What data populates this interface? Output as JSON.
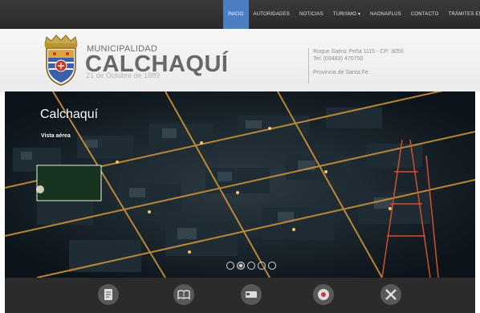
{
  "nav": {
    "items": [
      {
        "label": "Inicio",
        "active": true
      },
      {
        "label": "Autoridades"
      },
      {
        "label": "Noticias"
      },
      {
        "label": "Turismo ▾"
      },
      {
        "label": "Naonaplus"
      },
      {
        "label": "Contacto"
      },
      {
        "label": "Trámites en línea ▾"
      }
    ]
  },
  "header": {
    "brand_sup": "MUNICIPALIDAD",
    "brand_main": "CALCHAQUÍ",
    "brand_date": "21 de Octubre de 1889",
    "address": "Roque Saénz Peña 1115 - CP: 3050",
    "phone": "Tel: (03483) 470750",
    "province": "Provincia de Santa Fe"
  },
  "hero": {
    "title": "Calchaquí",
    "subtitle": "Vista aérea",
    "slides": 5,
    "active_slide": 2
  },
  "quick_access": {
    "icons": [
      "document-icon",
      "book-icon",
      "bed-icon",
      "disc-icon",
      "tools-icon"
    ]
  },
  "colors": {
    "nav_bg": "#2a2a2a",
    "nav_active": "#4b7fc2",
    "brand_text": "#686868"
  }
}
